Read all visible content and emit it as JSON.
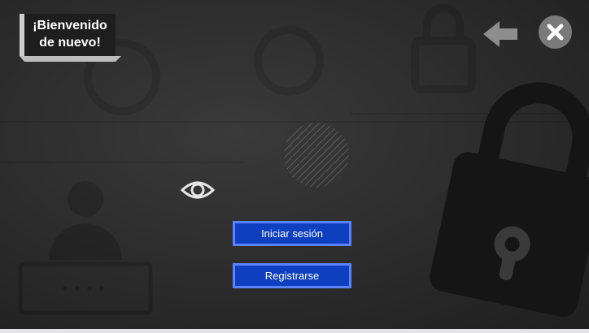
{
  "welcome": {
    "line1": "¡Bienvenido",
    "line2": "de nuevo!"
  },
  "icons": {
    "back": "arrow-left-icon",
    "close": "close-icon",
    "eye": "eye-icon",
    "lock": "padlock-icon",
    "user": "user-icon"
  },
  "buttons": {
    "login_label": "Iniciar sesión",
    "register_label": "Registrarse"
  },
  "colors": {
    "button_fill": "#0d3fbf",
    "button_border": "#5b82ff",
    "background": "#2b2b2b"
  }
}
